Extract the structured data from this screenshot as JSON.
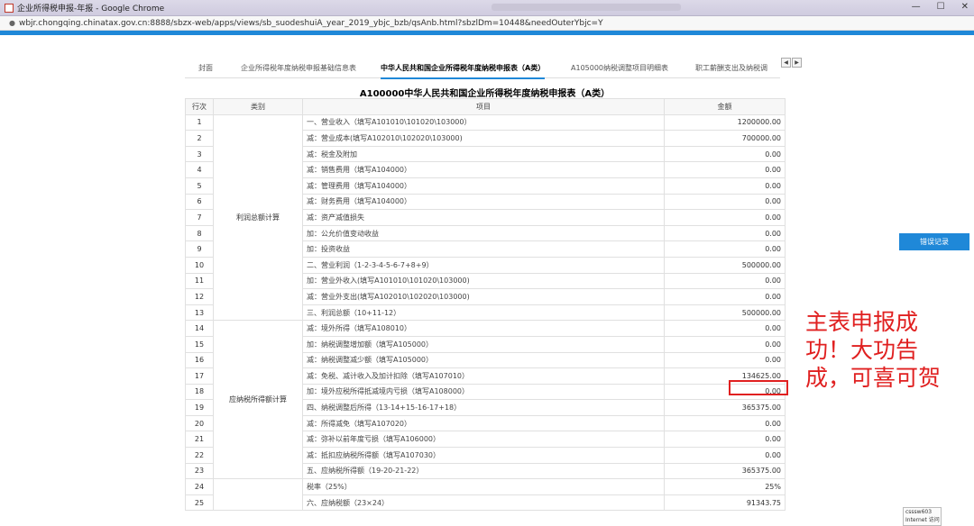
{
  "window": {
    "title": "企业所得税申报-年报 - Google Chrome",
    "controls": {
      "minimize": "—",
      "maximize": "☐",
      "close": "✕"
    }
  },
  "address": {
    "url": "wbjr.chongqing.chinatax.gov.cn:8888/sbzx-web/apps/views/sb_suodeshuiA_year_2019_ybjc_bzb/qsAnb.html?sbzlDm=10448&needOuterYbjc=Y"
  },
  "tabs": [
    "封面",
    "企业所得税年度纳税申报基础信息表",
    "中华人民共和国企业所得税年度纳税申报表（A类）",
    "A105000纳税调整项目明细表",
    "职工薪酬支出及纳税调"
  ],
  "tab_arrows": [
    "◀",
    "▶"
  ],
  "form": {
    "title": "A100000中华人民共和国企业所得税年度纳税申报表（A类）",
    "headers": {
      "no": "行次",
      "category": "类别",
      "item": "项目",
      "amount": "金额"
    },
    "categories": {
      "profit": "利润总额计算",
      "taxable": "应纳税所得额计算"
    },
    "rows": [
      {
        "no": "1",
        "item": "一、营业收入（填写A101010\\101020\\103000）",
        "amount": "1200000.00"
      },
      {
        "no": "2",
        "item": "减：营业成本(填写A102010\\102020\\103000)",
        "amount": "700000.00"
      },
      {
        "no": "3",
        "item": "减：税金及附加",
        "amount": "0.00"
      },
      {
        "no": "4",
        "item": "减：销售费用（填写A104000）",
        "amount": "0.00"
      },
      {
        "no": "5",
        "item": "减：管理费用（填写A104000）",
        "amount": "0.00"
      },
      {
        "no": "6",
        "item": "减：财务费用（填写A104000）",
        "amount": "0.00"
      },
      {
        "no": "7",
        "item": "减：资产减值损失",
        "amount": "0.00"
      },
      {
        "no": "8",
        "item": "加：公允价值变动收益",
        "amount": "0.00"
      },
      {
        "no": "9",
        "item": "加：投资收益",
        "amount": "0.00"
      },
      {
        "no": "10",
        "item": "二、营业利润（1-2-3-4-5-6-7+8+9）",
        "amount": "500000.00"
      },
      {
        "no": "11",
        "item": "加：营业外收入(填写A101010\\101020\\103000)",
        "amount": "0.00"
      },
      {
        "no": "12",
        "item": "减：营业外支出(填写A102010\\102020\\103000)",
        "amount": "0.00"
      },
      {
        "no": "13",
        "item": "三、利润总额（10+11-12）",
        "amount": "500000.00"
      },
      {
        "no": "14",
        "item": "减：境外所得（填写A108010）",
        "amount": "0.00"
      },
      {
        "no": "15",
        "item": "加：纳税调整增加额（填写A105000）",
        "amount": "0.00"
      },
      {
        "no": "16",
        "item": "减：纳税调整减少额（填写A105000）",
        "amount": "0.00"
      },
      {
        "no": "17",
        "item": "减：免税、减计收入及加计扣除（填写A107010）",
        "amount": "134625.00"
      },
      {
        "no": "18",
        "item": "加：境外应税所得抵减境内亏损（填写A108000）",
        "amount": "0.00"
      },
      {
        "no": "19",
        "item": "四、纳税调整后所得（13-14+15-16-17+18）",
        "amount": "365375.00"
      },
      {
        "no": "20",
        "item": "减：所得减免（填写A107020）",
        "amount": "0.00"
      },
      {
        "no": "21",
        "item": "减：弥补以前年度亏损（填写A106000）",
        "amount": "0.00"
      },
      {
        "no": "22",
        "item": "减：抵扣应纳税所得额（填写A107030）",
        "amount": "0.00"
      },
      {
        "no": "23",
        "item": "五、应纳税所得额（19-20-21-22）",
        "amount": "365375.00"
      },
      {
        "no": "24",
        "item": "税率（25%）",
        "amount": "25%"
      },
      {
        "no": "25",
        "item": "六、应纳税额（23×24）",
        "amount": "91343.75"
      }
    ]
  },
  "annotation": "主表申报成功！大功告成，可喜可贺",
  "side_button": "错误记录",
  "status": {
    "line1": "csssw603",
    "line2": "Internet 访问"
  },
  "colors": {
    "accent": "#1f88d8",
    "highlight": "#e02020"
  }
}
